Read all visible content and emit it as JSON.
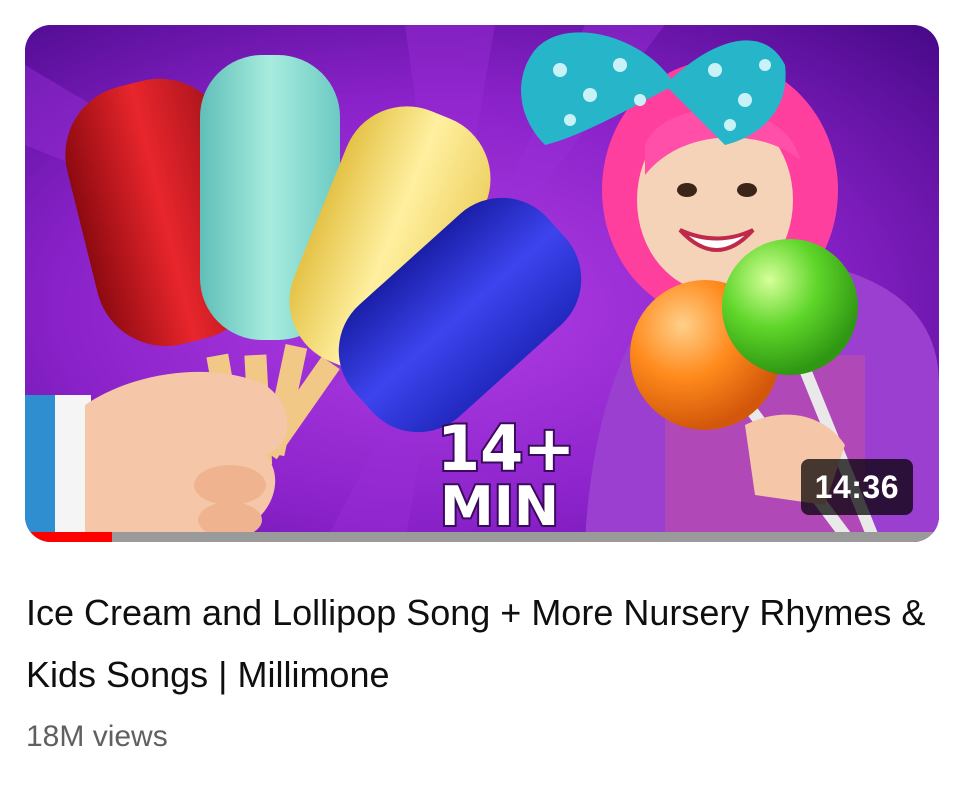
{
  "video": {
    "title": "Ice Cream and Lollipop Song + More Nursery Rhymes & Kids Songs | Millimone",
    "views": "18M views",
    "duration": "14:36",
    "progress_fraction": 0.095,
    "thumbnail_text": [
      "14+",
      "MIN"
    ]
  },
  "colors": {
    "progress_played": "#ff0000",
    "progress_track": "#9a9a9a",
    "title": "#0f0f0f",
    "meta": "#606060"
  }
}
